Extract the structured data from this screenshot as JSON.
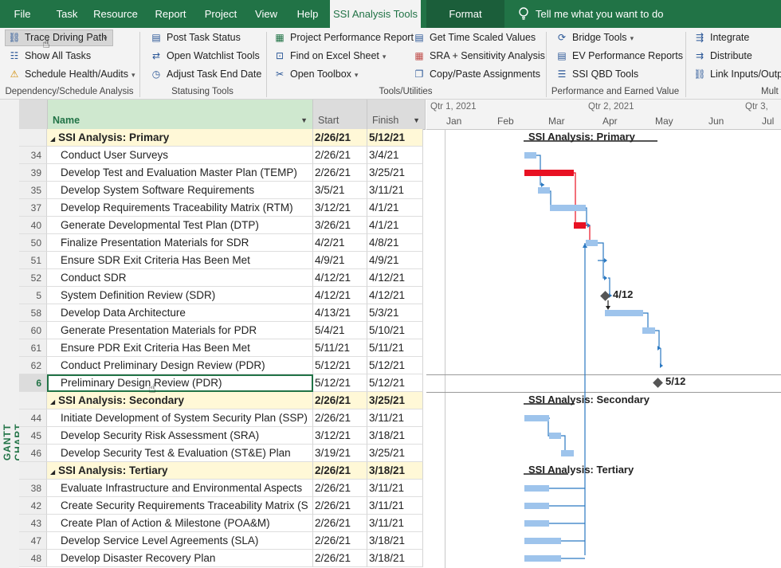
{
  "menu": {
    "tabs": [
      "File",
      "Task",
      "Resource",
      "Report",
      "Project",
      "View",
      "Help",
      "SSI Analysis Tools",
      "Format"
    ],
    "tell_me": "Tell me what you want to do"
  },
  "ribbon": {
    "group1": {
      "items": [
        "Trace Driving Path",
        "Show All Tasks",
        "Schedule Health/Audits"
      ],
      "label": "Dependency/Schedule Analysis"
    },
    "group2": {
      "items": [
        "Post Task Status",
        "Open Watchlist Tools",
        "Adjust Task End Date"
      ],
      "label": "Statusing Tools"
    },
    "group3": {
      "items": [
        "Project Performance Report",
        "Find on Excel Sheet",
        "Open Toolbox",
        "Get Time Scaled Values",
        "SRA + Sensitivity Analysis",
        "Copy/Paste Assignments"
      ],
      "label": "Tools/Utilities"
    },
    "group4": {
      "items": [
        "Bridge Tools",
        "EV Performance Reports",
        "SSI QBD Tools"
      ],
      "label": "Performance and Earned Value"
    },
    "group5": {
      "items": [
        "Integrate",
        "Distribute",
        "Link Inputs/Outp"
      ],
      "label": "Mult"
    }
  },
  "side_label": "GANTT CHART",
  "grid": {
    "headers": {
      "name": "Name",
      "start": "Start",
      "finish": "Finish"
    },
    "rows": [
      {
        "id": "",
        "name": "SSI Analysis: Primary",
        "start": "2/26/21",
        "finish": "5/12/21",
        "summary": true
      },
      {
        "id": "34",
        "name": "Conduct User Surveys",
        "start": "2/26/21",
        "finish": "3/4/21"
      },
      {
        "id": "39",
        "name": "Develop Test and Evaluation Master Plan (TEMP)",
        "start": "2/26/21",
        "finish": "3/25/21"
      },
      {
        "id": "35",
        "name": "Develop System Software Requirements",
        "start": "3/5/21",
        "finish": "3/11/21"
      },
      {
        "id": "37",
        "name": "Develop Requirements Traceability Matrix (RTM)",
        "start": "3/12/21",
        "finish": "4/1/21"
      },
      {
        "id": "40",
        "name": "Generate Developmental Test Plan (DTP)",
        "start": "3/26/21",
        "finish": "4/1/21"
      },
      {
        "id": "50",
        "name": "Finalize Presentation Materials for SDR",
        "start": "4/2/21",
        "finish": "4/8/21"
      },
      {
        "id": "51",
        "name": "Ensure SDR Exit Criteria Has Been Met",
        "start": "4/9/21",
        "finish": "4/9/21"
      },
      {
        "id": "52",
        "name": "Conduct SDR",
        "start": "4/12/21",
        "finish": "4/12/21"
      },
      {
        "id": "5",
        "name": "System Definition Review (SDR)",
        "start": "4/12/21",
        "finish": "4/12/21"
      },
      {
        "id": "58",
        "name": "Develop Data Architecture",
        "start": "4/13/21",
        "finish": "5/3/21"
      },
      {
        "id": "60",
        "name": "Generate Presentation Materials for PDR",
        "start": "5/4/21",
        "finish": "5/10/21"
      },
      {
        "id": "61",
        "name": "Ensure PDR Exit Criteria Has Been Met",
        "start": "5/11/21",
        "finish": "5/11/21"
      },
      {
        "id": "62",
        "name": "Conduct Preliminary Design Review (PDR)",
        "start": "5/12/21",
        "finish": "5/12/21"
      },
      {
        "id": "6",
        "name": "Preliminary Design Review (PDR)",
        "start": "5/12/21",
        "finish": "5/12/21",
        "selected": true
      },
      {
        "id": "",
        "name": "SSI Analysis: Secondary",
        "start": "2/26/21",
        "finish": "3/25/21",
        "summary": true
      },
      {
        "id": "44",
        "name": "Initiate Development of System Security Plan (SSP)",
        "start": "2/26/21",
        "finish": "3/11/21"
      },
      {
        "id": "45",
        "name": "Develop Security Risk Assessment (SRA)",
        "start": "3/12/21",
        "finish": "3/18/21"
      },
      {
        "id": "46",
        "name": "Develop Security Test & Evaluation (ST&E) Plan",
        "start": "3/19/21",
        "finish": "3/25/21"
      },
      {
        "id": "",
        "name": "SSI Analysis: Tertiary",
        "start": "2/26/21",
        "finish": "3/18/21",
        "summary": true
      },
      {
        "id": "38",
        "name": "Evaluate Infrastructure and Environmental Aspects",
        "start": "2/26/21",
        "finish": "3/11/21"
      },
      {
        "id": "42",
        "name": "Create Security Requirements Traceability Matrix (S",
        "start": "2/26/21",
        "finish": "3/11/21"
      },
      {
        "id": "43",
        "name": "Create Plan of Action & Milestone (POA&M)",
        "start": "2/26/21",
        "finish": "3/11/21"
      },
      {
        "id": "47",
        "name": "Develop Service Level Agreements (SLA)",
        "start": "2/26/21",
        "finish": "3/18/21"
      },
      {
        "id": "48",
        "name": "Develop Disaster Recovery Plan",
        "start": "2/26/21",
        "finish": "3/18/21"
      }
    ]
  },
  "timeline": {
    "quarters": [
      "Qtr 1, 2021",
      "Qtr 2, 2021",
      "Qtr 3,"
    ],
    "months": [
      "Jan",
      "Feb",
      "Mar",
      "Apr",
      "May",
      "Jun",
      "Jul"
    ]
  },
  "gantt_labels": {
    "primary": "SSI Analysis: Primary",
    "secondary": "SSI Analysis: Secondary",
    "tertiary": "SSI Analysis: Tertiary",
    "milestone_sdr": "4/12",
    "milestone_pdr": "5/12"
  },
  "colors": {
    "accent": "#217346",
    "task_bar": "#9ec4ec",
    "critical_bar": "#e81123",
    "summary_fill": "#fff8d7",
    "link": "#2b79c2"
  }
}
